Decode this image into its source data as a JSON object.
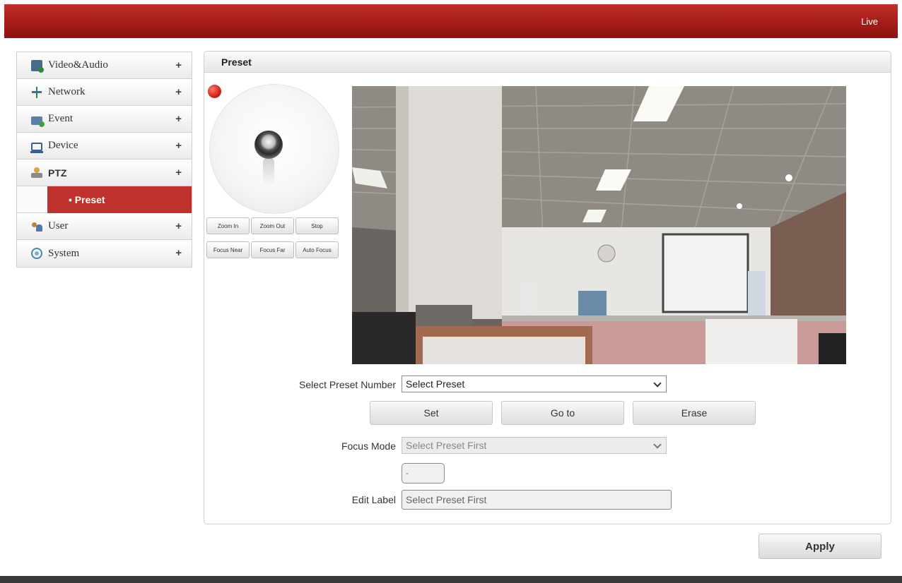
{
  "header": {
    "live_link": "Live"
  },
  "sidebar": {
    "items": [
      {
        "label": "Video&Audio",
        "expand": "+"
      },
      {
        "label": "Network",
        "expand": "+"
      },
      {
        "label": "Event",
        "expand": "+"
      },
      {
        "label": "Device",
        "expand": "+"
      },
      {
        "label": "PTZ",
        "expand": "+"
      },
      {
        "label": "User",
        "expand": "+"
      },
      {
        "label": "System",
        "expand": "+"
      }
    ],
    "ptz_subitem": "• Preset"
  },
  "panel": {
    "title": "Preset"
  },
  "ptz_controls": {
    "zoom_in": "Zoom In",
    "zoom_out": "Zoom Out",
    "stop": "Stop",
    "focus_near": "Focus Near",
    "focus_far": "Focus Far",
    "auto_focus": "Auto Focus"
  },
  "form": {
    "preset_number_label": "Select Preset Number",
    "preset_number_value": "Select Preset",
    "set_button": "Set",
    "goto_button": "Go to",
    "erase_button": "Erase",
    "focus_mode_label": "Focus Mode",
    "focus_mode_value": "Select Preset First",
    "small_field_value": "-",
    "edit_label_label": "Edit Label",
    "edit_label_value": "Select Preset First"
  },
  "footer": {
    "apply_button": "Apply"
  },
  "colors": {
    "brand_red": "#b0221c",
    "active_item": "#c0322d"
  }
}
